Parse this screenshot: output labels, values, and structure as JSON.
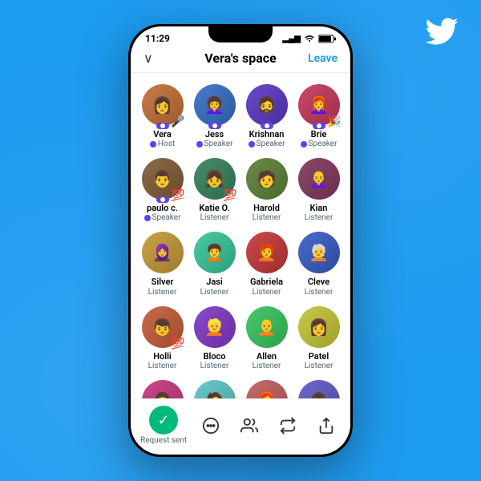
{
  "background_color": "#1d9bf0",
  "twitter_logo": "🐦",
  "phone": {
    "status_bar": {
      "time": "11:29",
      "signal": "▂▄▆",
      "wifi": "WiFi",
      "battery": "🔋"
    },
    "header": {
      "chevron": "∨",
      "title": "Vera's space",
      "leave_label": "Leave"
    },
    "participants": [
      {
        "name": "Vera",
        "role": "Host",
        "has_mic": true,
        "avatar_class": "av-vera",
        "emoji": "🎤"
      },
      {
        "name": "Jess",
        "role": "Speaker",
        "has_mic": true,
        "avatar_class": "av-jess",
        "emoji": null
      },
      {
        "name": "Krishnan",
        "role": "Speaker",
        "has_mic": true,
        "avatar_class": "av-krishnan",
        "emoji": null
      },
      {
        "name": "Brie",
        "role": "Speaker",
        "has_mic": true,
        "avatar_class": "av-brie",
        "emoji": "🎉"
      },
      {
        "name": "paulo c.",
        "role": "Speaker",
        "has_mic": true,
        "avatar_class": "av-paulo",
        "emoji": "💯"
      },
      {
        "name": "Katie O.",
        "role": "Listener",
        "has_mic": false,
        "avatar_class": "av-katie",
        "emoji": "💯"
      },
      {
        "name": "Harold",
        "role": "Listener",
        "has_mic": false,
        "avatar_class": "av-harold",
        "emoji": null
      },
      {
        "name": "Kian",
        "role": "Listener",
        "has_mic": false,
        "avatar_class": "av-kian",
        "emoji": null
      },
      {
        "name": "Silver",
        "role": "Listener",
        "has_mic": false,
        "avatar_class": "av-silver",
        "emoji": null
      },
      {
        "name": "Jasi",
        "role": "Listener",
        "has_mic": false,
        "avatar_class": "av-jasi",
        "emoji": null
      },
      {
        "name": "Gabriela",
        "role": "Listener",
        "has_mic": false,
        "avatar_class": "av-gabriela",
        "emoji": null
      },
      {
        "name": "Cleve",
        "role": "Listener",
        "has_mic": false,
        "avatar_class": "av-cleve",
        "emoji": null
      },
      {
        "name": "Holli",
        "role": "Listener",
        "has_mic": false,
        "avatar_class": "av-holli",
        "emoji": "💯"
      },
      {
        "name": "Bloco",
        "role": "Listener",
        "has_mic": false,
        "avatar_class": "av-bloco",
        "emoji": null
      },
      {
        "name": "Allen",
        "role": "Listener",
        "has_mic": false,
        "avatar_class": "av-allen",
        "emoji": null
      },
      {
        "name": "Patel",
        "role": "Listener",
        "has_mic": false,
        "avatar_class": "av-patel",
        "emoji": null
      },
      {
        "name": "",
        "role": "",
        "has_mic": false,
        "avatar_class": "av-row5a",
        "emoji": null
      },
      {
        "name": "",
        "role": "",
        "has_mic": false,
        "avatar_class": "av-row5b",
        "emoji": null
      },
      {
        "name": "",
        "role": "",
        "has_mic": false,
        "avatar_class": "av-row5c",
        "emoji": null
      },
      {
        "name": "",
        "role": "",
        "has_mic": false,
        "avatar_class": "av-row5d",
        "emoji": null
      }
    ],
    "bottom_bar": {
      "request_sent_label": "Request sent",
      "icons": [
        "💬",
        "👥",
        "🔄",
        "⬆"
      ]
    }
  }
}
